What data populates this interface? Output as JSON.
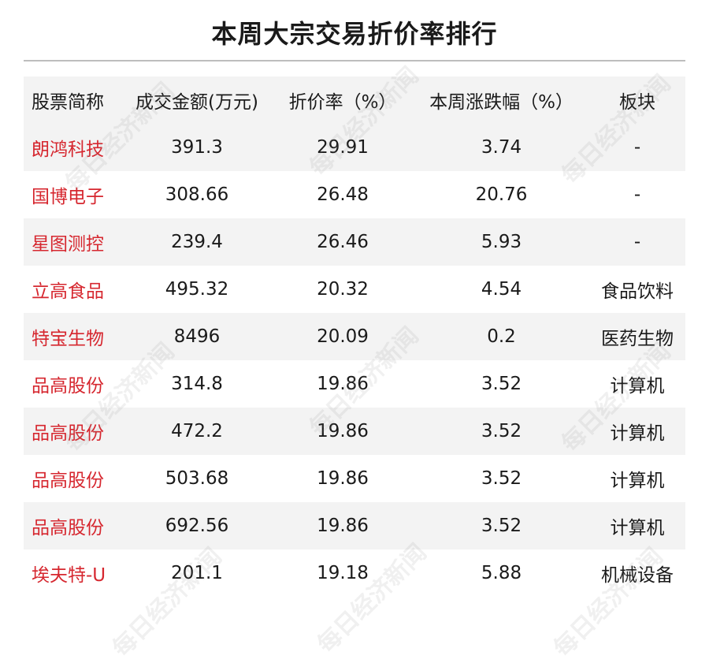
{
  "title": "本周大宗交易折价率排行",
  "columns": [
    "股票简称",
    "成交金额(万元)",
    "折价率（%）",
    "本周涨跌幅（%）",
    "板块"
  ],
  "rows": [
    [
      "朗鸿科技",
      "391.3",
      "29.91",
      "3.74",
      "-"
    ],
    [
      "国博电子",
      "308.66",
      "26.48",
      "20.76",
      "-"
    ],
    [
      "星图测控",
      "239.4",
      "26.46",
      "5.93",
      "-"
    ],
    [
      "立高食品",
      "495.32",
      "20.32",
      "4.54",
      "食品饮料"
    ],
    [
      "特宝生物",
      "8496",
      "20.09",
      "0.2",
      "医药生物"
    ],
    [
      "品高股份",
      "314.8",
      "19.86",
      "3.52",
      "计算机"
    ],
    [
      "品高股份",
      "472.2",
      "19.86",
      "3.52",
      "计算机"
    ],
    [
      "品高股份",
      "503.68",
      "19.86",
      "3.52",
      "计算机"
    ],
    [
      "品高股份",
      "692.56",
      "19.86",
      "3.52",
      "计算机"
    ],
    [
      "埃夫特-U",
      "201.1",
      "19.18",
      "5.88",
      "机械设备"
    ]
  ],
  "watermark_text": "每日经济新闻",
  "colors": {
    "name_red": "#d6272f",
    "stripe": "#f3f3f3",
    "divider": "#bdbdbd"
  }
}
